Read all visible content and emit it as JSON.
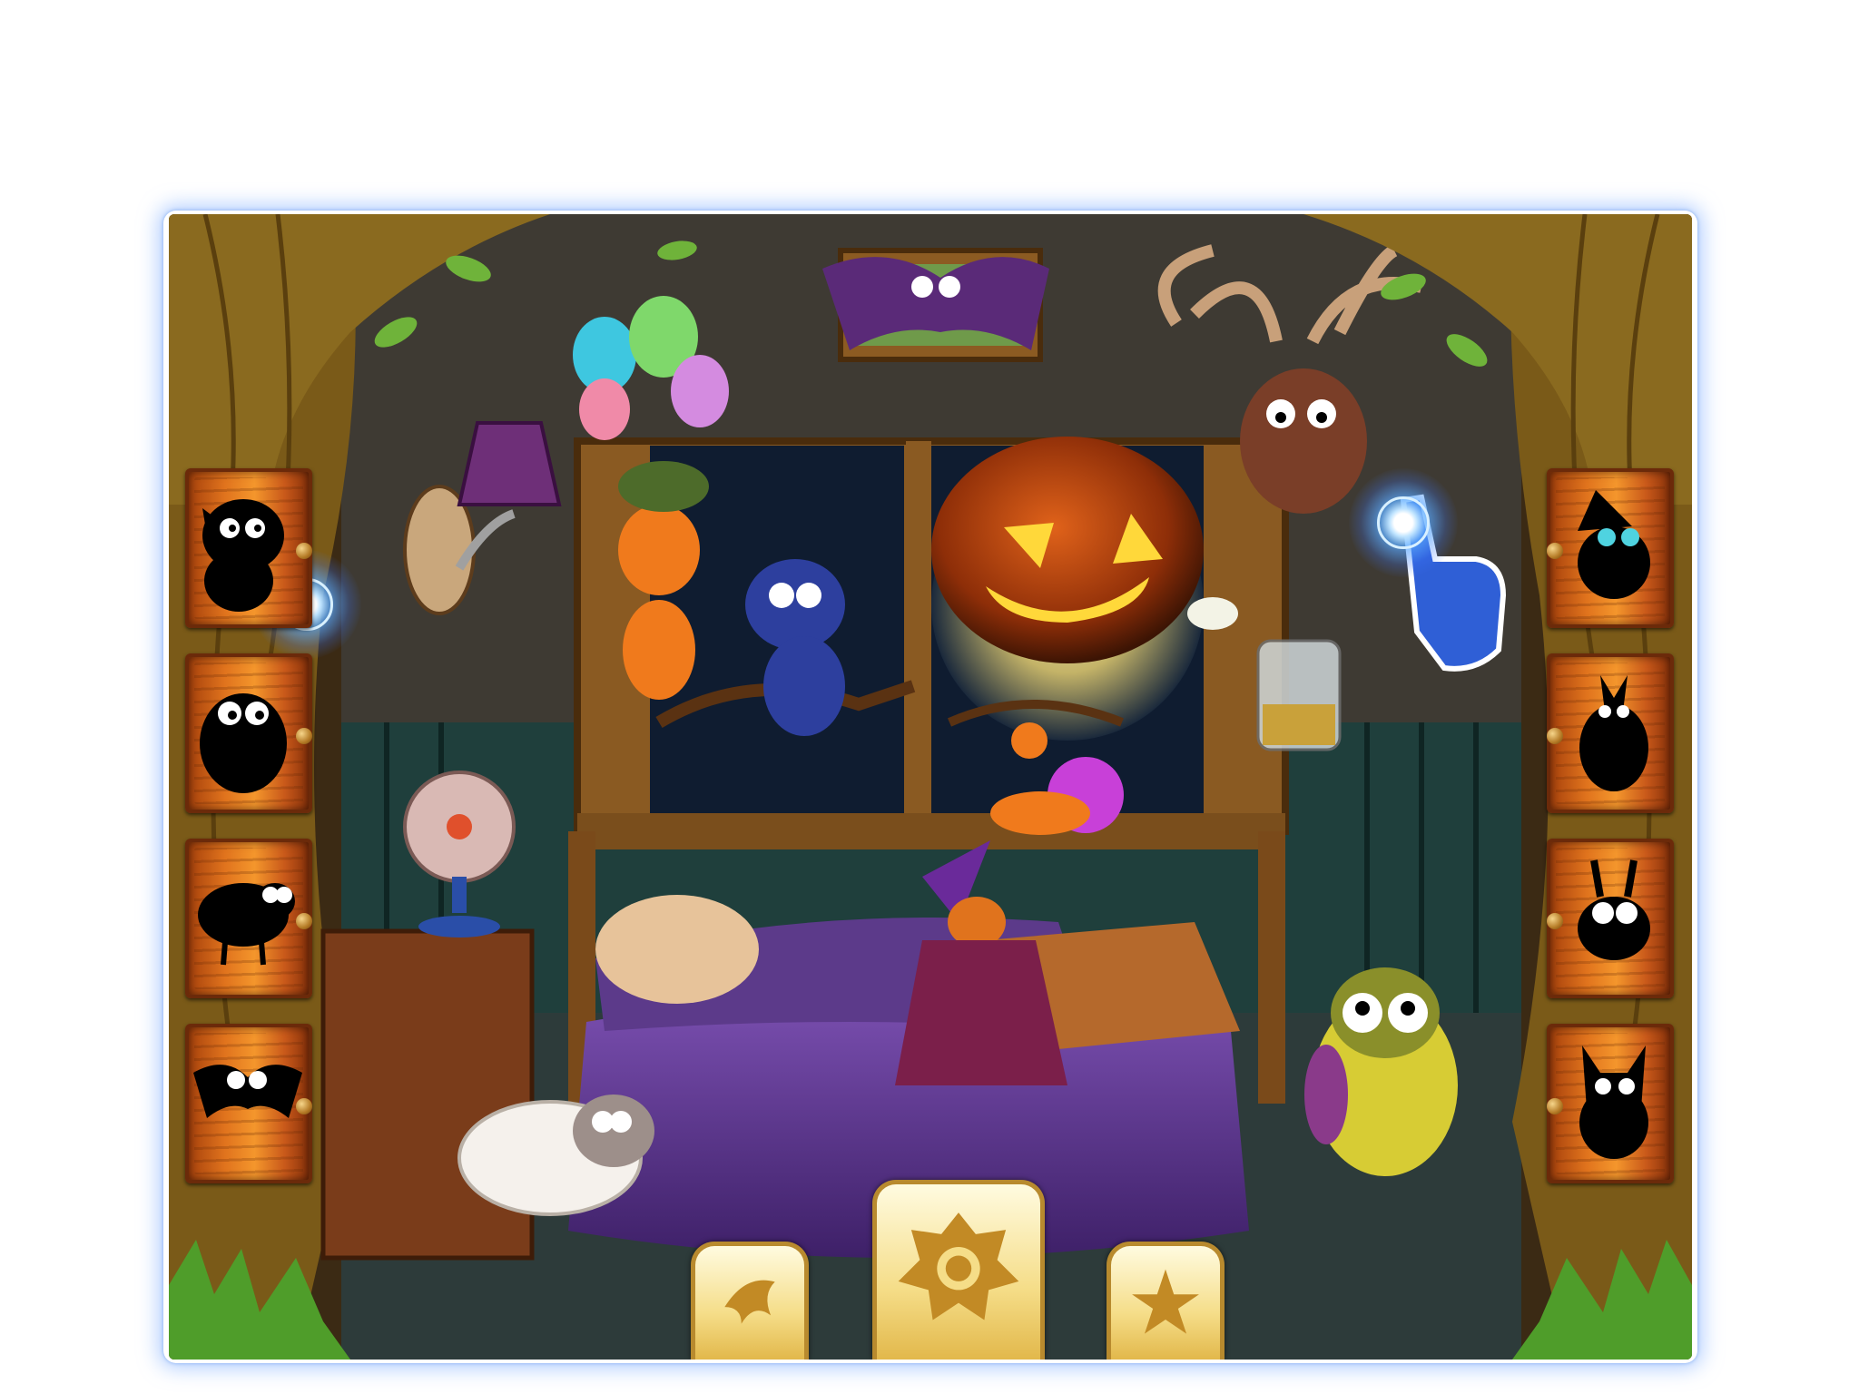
{
  "app": {
    "scene": "halloween-bedroom"
  },
  "left_slots": [
    {
      "silhouette": "bat-creature",
      "hint_active": true
    },
    {
      "silhouette": "owl-blob",
      "hint_active": false
    },
    {
      "silhouette": "sheep",
      "hint_active": false
    },
    {
      "silhouette": "bat",
      "hint_active": false
    }
  ],
  "right_slots": [
    {
      "silhouette": "witch-cat",
      "hint_active": false
    },
    {
      "silhouette": "horned-monster",
      "hint_active": false
    },
    {
      "silhouette": "bunny-snail",
      "hint_active": false
    },
    {
      "silhouette": "cat-devil",
      "hint_active": false
    }
  ],
  "bottom_buttons": [
    {
      "icon": "dolphin-icon"
    },
    {
      "icon": "sun-icon"
    },
    {
      "icon": "star-icon"
    }
  ],
  "colors": {
    "frame_glow": "#7fb3ff",
    "tree": "#7a5a18",
    "slot": "#e0731d",
    "button": "#f5dd88"
  }
}
